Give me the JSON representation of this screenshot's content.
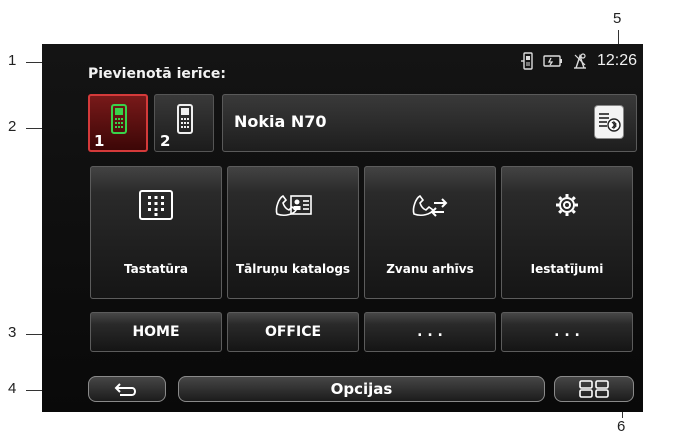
{
  "callouts": [
    "1",
    "2",
    "3",
    "4",
    "5",
    "6"
  ],
  "status": {
    "clock": "12:26"
  },
  "device": {
    "label": "Pievienotā ierīce:",
    "name": "Nokia N70",
    "phones": [
      {
        "num": "1",
        "state": "active"
      },
      {
        "num": "2",
        "state": "inactive"
      }
    ]
  },
  "tiles": [
    {
      "label": "Tastatūra",
      "icon": "keypad-icon"
    },
    {
      "label": "Tālruņu katalogs",
      "icon": "phonebook-icon"
    },
    {
      "label": "Zvanu arhīvs",
      "icon": "call-log-icon"
    },
    {
      "label": "Iestatījumi",
      "icon": "settings-gear-icon"
    }
  ],
  "presets": [
    "HOME",
    "OFFICE",
    ". . .",
    ". . ."
  ],
  "bottom_bar": {
    "options": "Opcijas",
    "back_icon": "back-arrow-icon",
    "menu_icon": "grid-menu-icon"
  },
  "colors": {
    "active_phone": "#d43a3a",
    "screen_bg": "#0e0e0e"
  }
}
